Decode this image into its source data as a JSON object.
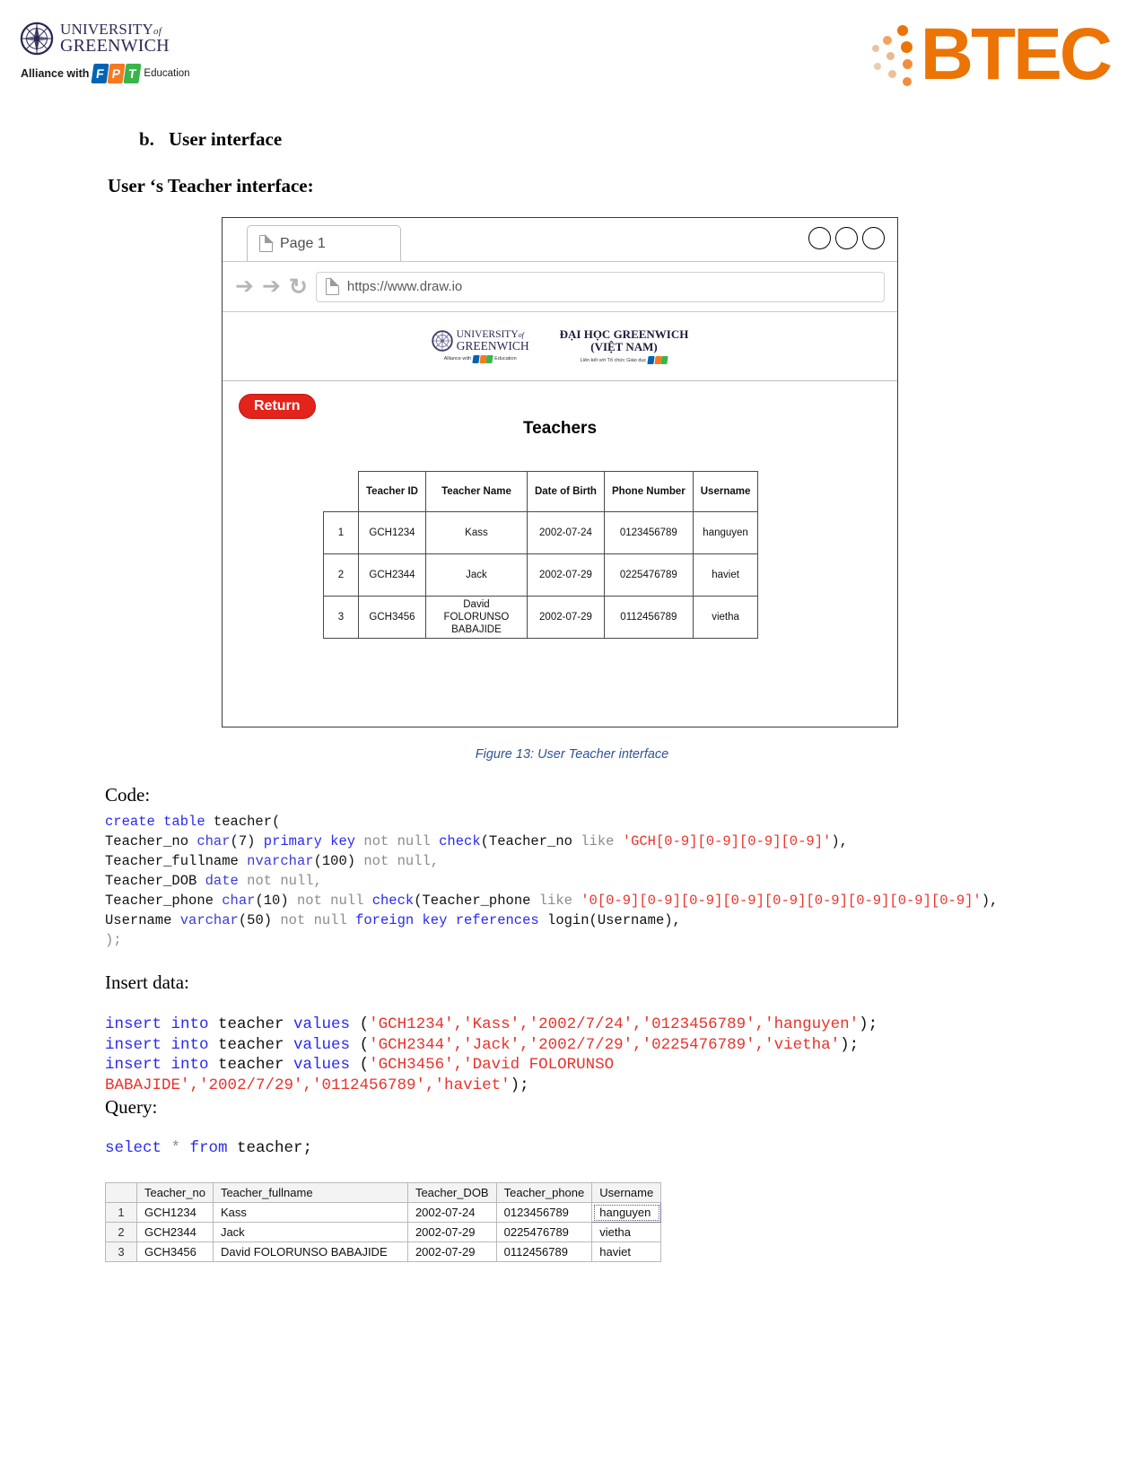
{
  "header": {
    "university_line1": "UNIVERSITY",
    "university_of": "of",
    "university_line2": "GREENWICH",
    "alliance_prefix": "Alliance with",
    "alliance_suffix": "Education",
    "fpt_letters": [
      "F",
      "P",
      "T"
    ],
    "btec_logo_text": "BTEC"
  },
  "headings": {
    "section_number": "b.",
    "section_title": "User interface",
    "subsection_title": "User ‘s Teacher interface:"
  },
  "mockup": {
    "tab_label": "Page 1",
    "tab_icon": "page-icon",
    "back_icon": "arrow-left-icon",
    "forward_icon": "arrow-right-icon",
    "reload_icon": "reload-icon",
    "url_icon": "page-icon",
    "url": "https://www.draw.io",
    "window_buttons": [
      "minimize-circle",
      "maximize-circle",
      "close-circle"
    ],
    "banner": {
      "uog_line1": "UNIVERSITY",
      "uog_of": "of",
      "uog_line2": "GREENWICH",
      "uog_sub_prefix": "Alliance with",
      "uog_sub_suffix": "Education",
      "dhg_line1": "ĐẠI HỌC GREENWICH",
      "dhg_line2": "(VIỆT NAM)",
      "dhg_sub": "Liên kết với Tổ chức Giáo dục"
    },
    "return_button": "Return",
    "page_title": "Teachers",
    "table": {
      "columns": [
        "Teacher ID",
        "Teacher Name",
        "Date of Birth",
        "Phone Number",
        "Username"
      ],
      "rows": [
        {
          "index": "1",
          "id": "GCH1234",
          "name": "Kass",
          "dob": "2002-07-24",
          "phone": "0123456789",
          "username": "hanguyen"
        },
        {
          "index": "2",
          "id": "GCH2344",
          "name": "Jack",
          "dob": "2002-07-29",
          "phone": "0225476789",
          "username": "haviet"
        },
        {
          "index": "3",
          "id": "GCH3456",
          "name": "David FOLORUNSO BABAJIDE",
          "dob": "2002-07-29",
          "phone": "0112456789",
          "username": "vietha"
        }
      ]
    }
  },
  "figure_caption": "Figure 13: User Teacher interface",
  "labels": {
    "code": "Code:",
    "insert_data": "Insert data:",
    "query": "Query:"
  },
  "create_code": {
    "l1": {
      "kw": "create table",
      "rest": " teacher("
    },
    "l2_a": "Teacher_no ",
    "l2_type": "char",
    "l2_b": "(7) ",
    "l2_pk": "primary key",
    "l2_nn": " not null ",
    "l2_check": "check",
    "l2_c": "(Teacher_no ",
    "l2_like": "like ",
    "l2_str": "'GCH[0-9][0-9][0-9][0-9]'",
    "l2_d": "),",
    "l3_a": "Teacher_fullname ",
    "l3_type": "nvarchar",
    "l3_b": "(100) ",
    "l3_nn": "not null,",
    "l4_a": "Teacher_DOB ",
    "l4_type": "date",
    "l4_b": " not null,",
    "l5_a": "Teacher_phone ",
    "l5_type": "char",
    "l5_b": "(10) ",
    "l5_nn": "not null ",
    "l5_check": "check",
    "l5_c": "(Teacher_phone ",
    "l5_like": "like ",
    "l5_str": "'0[0-9][0-9][0-9][0-9][0-9][0-9][0-9][0-9][0-9]'",
    "l5_d": "),",
    "l6_a": "Username ",
    "l6_type": "varchar",
    "l6_b": "(50) ",
    "l6_nn": "not null ",
    "l6_fk": "foreign key references",
    "l6_c": " login(Username),",
    "l7": ");"
  },
  "insert_code": {
    "lines": [
      {
        "kw1": "insert into",
        "t": " teacher ",
        "kw2": "values",
        "open": " (",
        "vals": "'GCH1234','Kass','2002/7/24','0123456789','hanguyen'",
        "close": ");"
      },
      {
        "kw1": "insert into",
        "t": " teacher ",
        "kw2": "values",
        "open": " (",
        "vals": "'GCH2344','Jack','2002/7/29','0225476789','vietha'",
        "close": ");"
      },
      {
        "kw1": "insert into",
        "t": " teacher ",
        "kw2": "values",
        "open": " (",
        "vals": "'GCH3456','David FOLORUNSO",
        "close": ""
      }
    ],
    "wrap_line": {
      "vals": "BABAJIDE','2002/7/29','0112456789','haviet'",
      "close": ");"
    }
  },
  "query_code": {
    "select": "select",
    "star": " * ",
    "from": "from",
    "table": " teacher;"
  },
  "result_grid": {
    "columns": [
      "Teacher_no",
      "Teacher_fullname",
      "Teacher_DOB",
      "Teacher_phone",
      "Username"
    ],
    "rows": [
      {
        "rn": "1",
        "teacher_no": "GCH1234",
        "fullname": "Kass",
        "dob": "2002-07-24",
        "phone": "0123456789",
        "username": "hanguyen"
      },
      {
        "rn": "2",
        "teacher_no": "GCH2344",
        "fullname": "Jack",
        "dob": "2002-07-29",
        "phone": "0225476789",
        "username": "vietha"
      },
      {
        "rn": "3",
        "teacher_no": "GCH3456",
        "fullname": "David FOLORUNSO BABAJIDE",
        "dob": "2002-07-29",
        "phone": "0112456789",
        "username": "haviet"
      }
    ]
  },
  "colors": {
    "btec_orange": "#ec7404",
    "uog_navy": "#2b2a55",
    "return_red": "#e2241b",
    "caption_blue": "#2f5496",
    "sql_keyword": "#2a2af0",
    "sql_string": "#e8332a",
    "sql_type": "#cf2a2a"
  }
}
